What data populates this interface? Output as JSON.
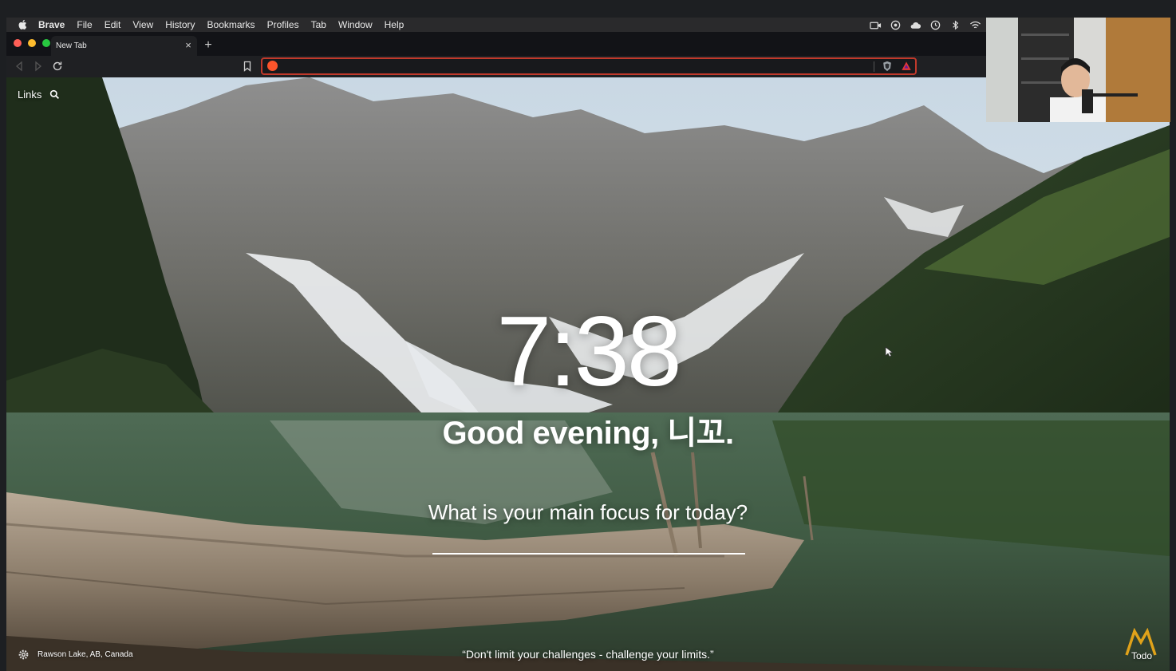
{
  "menubar": {
    "items": [
      "Brave",
      "File",
      "Edit",
      "View",
      "History",
      "Bookmarks",
      "Profiles",
      "Tab",
      "Window",
      "Help"
    ],
    "status_icons": [
      "camera-icon",
      "password-icon",
      "cloud-icon",
      "time-machine-icon",
      "bluetooth-icon",
      "wifi-icon"
    ]
  },
  "tabbar": {
    "tab_title": "New Tab",
    "close_glyph": "×",
    "new_tab_glyph": "+"
  },
  "toolbar": {
    "url_value": "",
    "url_placeholder": ""
  },
  "newtab": {
    "links_label": "Links",
    "clock": "7:38",
    "greeting": "Good evening, 니꼬.",
    "focus_question": "What is your main focus for today?",
    "focus_value": "",
    "location": "Rawson Lake, AB, Canada",
    "quote": "“Don't limit your challenges - challenge your limits.”",
    "todo_label": "Todo"
  },
  "colors": {
    "url_border": "#c0392b",
    "brave_orange": "#fb542b",
    "close_red": "#ff5f57",
    "minimize_yellow": "#febc2e",
    "zoom_green": "#28c840"
  }
}
